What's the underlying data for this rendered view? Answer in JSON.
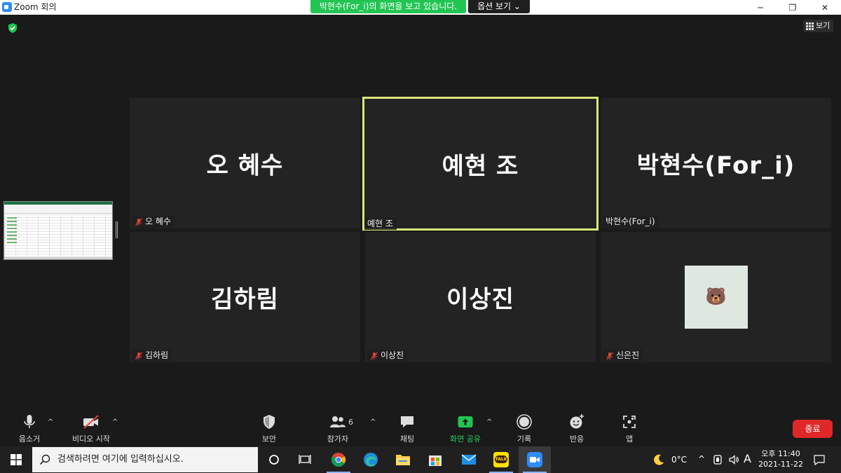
{
  "window": {
    "title": "Zoom 회의",
    "share_banner": "박현수(For_i)의 화면을 보고 있습니다.",
    "view_options": "옵션 보기",
    "gallery_view": "보기",
    "controls": {
      "minimize": "─",
      "restore": "❐",
      "close": "✕"
    }
  },
  "tiles": [
    {
      "big": "오 혜수",
      "tag": "오 혜수",
      "muted": true
    },
    {
      "big": "예현 조",
      "tag": "예현 조",
      "muted": false,
      "active": true
    },
    {
      "big": "박현수(For_i)",
      "tag": "박현수(For_i)",
      "muted": false
    },
    {
      "big": "김하림",
      "tag": "김하림",
      "muted": true
    },
    {
      "big": "이상진",
      "tag": "이상진",
      "muted": true
    },
    {
      "big": "",
      "tag": "신은진",
      "muted": true,
      "avatar": "bear-emoji-icon",
      "avatar_glyph": "🐻"
    }
  ],
  "toolbar": {
    "mute_label": "음소거",
    "video_label": "비디오 시작",
    "security_label": "보안",
    "participants_label": "참가자",
    "participants_count": "6",
    "chat_label": "채팅",
    "share_label": "화면 공유",
    "record_label": "기록",
    "reactions_label": "반응",
    "apps_label": "앱",
    "end_label": "종료"
  },
  "taskbar": {
    "search_placeholder": "검색하려면 여기에 입력하십시오.",
    "weather": "0°C",
    "ime": "A",
    "time": "오후 11:40",
    "date": "2021-11-22",
    "kakao_label": "TALK"
  },
  "colors": {
    "active_speaker_border": "#d9e67a",
    "share_green": "#23c552",
    "end_red": "#e02828",
    "tile_bg": "#232323",
    "mute_red": "#e0443a"
  }
}
